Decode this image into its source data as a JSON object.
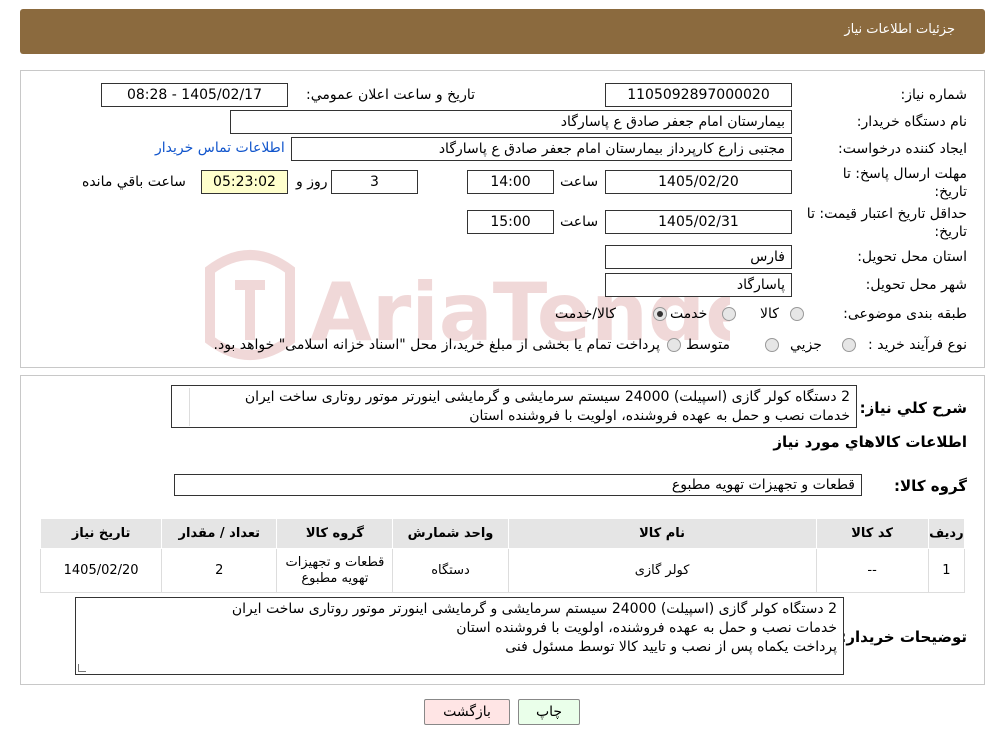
{
  "header": {
    "title": "جزئیات اطلاعات نیاز"
  },
  "fields": {
    "need_number_label": "شماره نیاز:",
    "need_number": "1105092897000020",
    "announce_label": "تاریخ و ساعت اعلان عمومي:",
    "announce_value": "1405/02/17 - 08:28",
    "buyer_org_label": "نام دستگاه خریدار:",
    "buyer_org": "بیمارستان امام جعفر صادق ع  پاسارگاد",
    "creator_label": "ایجاد کننده درخواست:",
    "creator": "مجتبی زارع کارپرداز بیمارستان امام جعفر صادق ع  پاسارگاد",
    "contact_link": "اطلاعات تماس خریدار",
    "deadline_label_1": "مهلت ارسال پاسخ: تا",
    "deadline_label_2": "تاریخ:",
    "deadline_date": "1405/02/20",
    "time_label": "ساعت",
    "deadline_time": "14:00",
    "days_value": "3",
    "days_label": "روز و",
    "remaining_time": "05:23:02",
    "remaining_label": "ساعت باقي مانده",
    "validity_label_1": "حداقل تاریخ اعتبار قیمت: تا",
    "validity_label_2": "تاریخ:",
    "validity_date": "1405/02/31",
    "validity_time": "15:00",
    "province_label": "استان محل تحویل:",
    "province": "فارس",
    "city_label": "شهر محل تحویل:",
    "city": "پاسارگاد",
    "category_label": "طبقه بندی موضوعی:",
    "category_options": [
      "کالا",
      "خدمت",
      "کالا/خدمت"
    ],
    "process_label": "نوع فرآیند خرید :",
    "process_options": [
      "جزیي",
      "متوسط"
    ],
    "process_note": "پرداخت تمام یا بخشی از مبلغ خرید،از محل \"اسناد خزانه اسلامی\" خواهد بود."
  },
  "description": {
    "label": "شرح کلي نیاز:",
    "line1": "2 دستگاه کولر گازی (اسپیلت) 24000 سیستم سرمایشی و گرمایشی اینورتر موتور روتاری ساخت ایران",
    "line2": "خدمات نصب و حمل به عهده فروشنده، اولویت با فروشنده استان"
  },
  "goods_info_title": "اطلاعات کالاهاي مورد نیاز",
  "goods_group": {
    "label": "گروه کالا:",
    "value": "قطعات و تجهیزات تهویه مطبوع"
  },
  "table": {
    "headers": [
      "ردیف",
      "کد کالا",
      "نام کالا",
      "واحد شمارش",
      "گروه کالا",
      "تعداد / مقدار",
      "تاریخ نیاز"
    ],
    "rows": [
      {
        "row": "1",
        "code": "--",
        "name": "کولر گازی",
        "unit": "دستگاه",
        "group_line1": "قطعات و تجهیزات",
        "group_line2": "تهویه مطبوع",
        "qty": "2",
        "date": "1405/02/20"
      }
    ]
  },
  "buyer_notes": {
    "label": "توضیحات خریدار:",
    "line1": "2 دستگاه کولر گازی (اسپیلت) 24000 سیستم سرمایشی و گرمایشی اینورتر موتور روتاری ساخت ایران",
    "line2": "خدمات نصب و حمل به عهده فروشنده، اولویت با فروشنده استان",
    "line3": "پرداخت یکماه پس از نصب و تایید کالا توسط مسئول فنی"
  },
  "buttons": {
    "print": "چاپ",
    "back": "بازگشت"
  },
  "watermark": {
    "text": "AriaTender.neT"
  },
  "colors": {
    "header": "#8b6a3e",
    "print_bg": "#eaffea",
    "back_bg": "#ffe5e5",
    "link": "#1155cc"
  }
}
